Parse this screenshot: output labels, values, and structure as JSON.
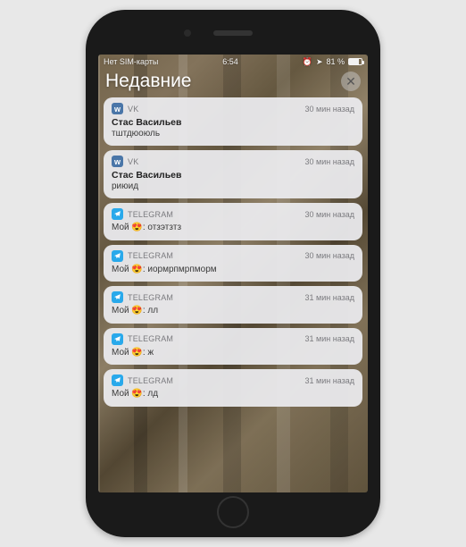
{
  "statusbar": {
    "carrier": "Нет SIM-карты",
    "time": "6:54",
    "battery_pct": "81 %"
  },
  "header": {
    "title": "Недавние"
  },
  "apps": {
    "vk": {
      "label": "VK"
    },
    "telegram": {
      "label": "TELEGRAM"
    }
  },
  "notifications": [
    {
      "app": "vk",
      "time": "30 мин назад",
      "title": "Стас Васильев",
      "body": "тштдюоюль"
    },
    {
      "app": "vk",
      "time": "30 мин назад",
      "title": "Стас Васильев",
      "body": "риюид"
    },
    {
      "app": "telegram",
      "time": "30 мин назад",
      "title": "Мой 😍:",
      "body": "отзэтзтз"
    },
    {
      "app": "telegram",
      "time": "30 мин назад",
      "title": "Мой 😍:",
      "body": "иормрпмрпморм"
    },
    {
      "app": "telegram",
      "time": "31 мин назад",
      "title": "Мой 😍:",
      "body": "лл"
    },
    {
      "app": "telegram",
      "time": "31 мин назад",
      "title": "Мой 😍:",
      "body": "ж"
    },
    {
      "app": "telegram",
      "time": "31 мин назад",
      "title": "Мой 😍:",
      "body": "лд"
    }
  ]
}
